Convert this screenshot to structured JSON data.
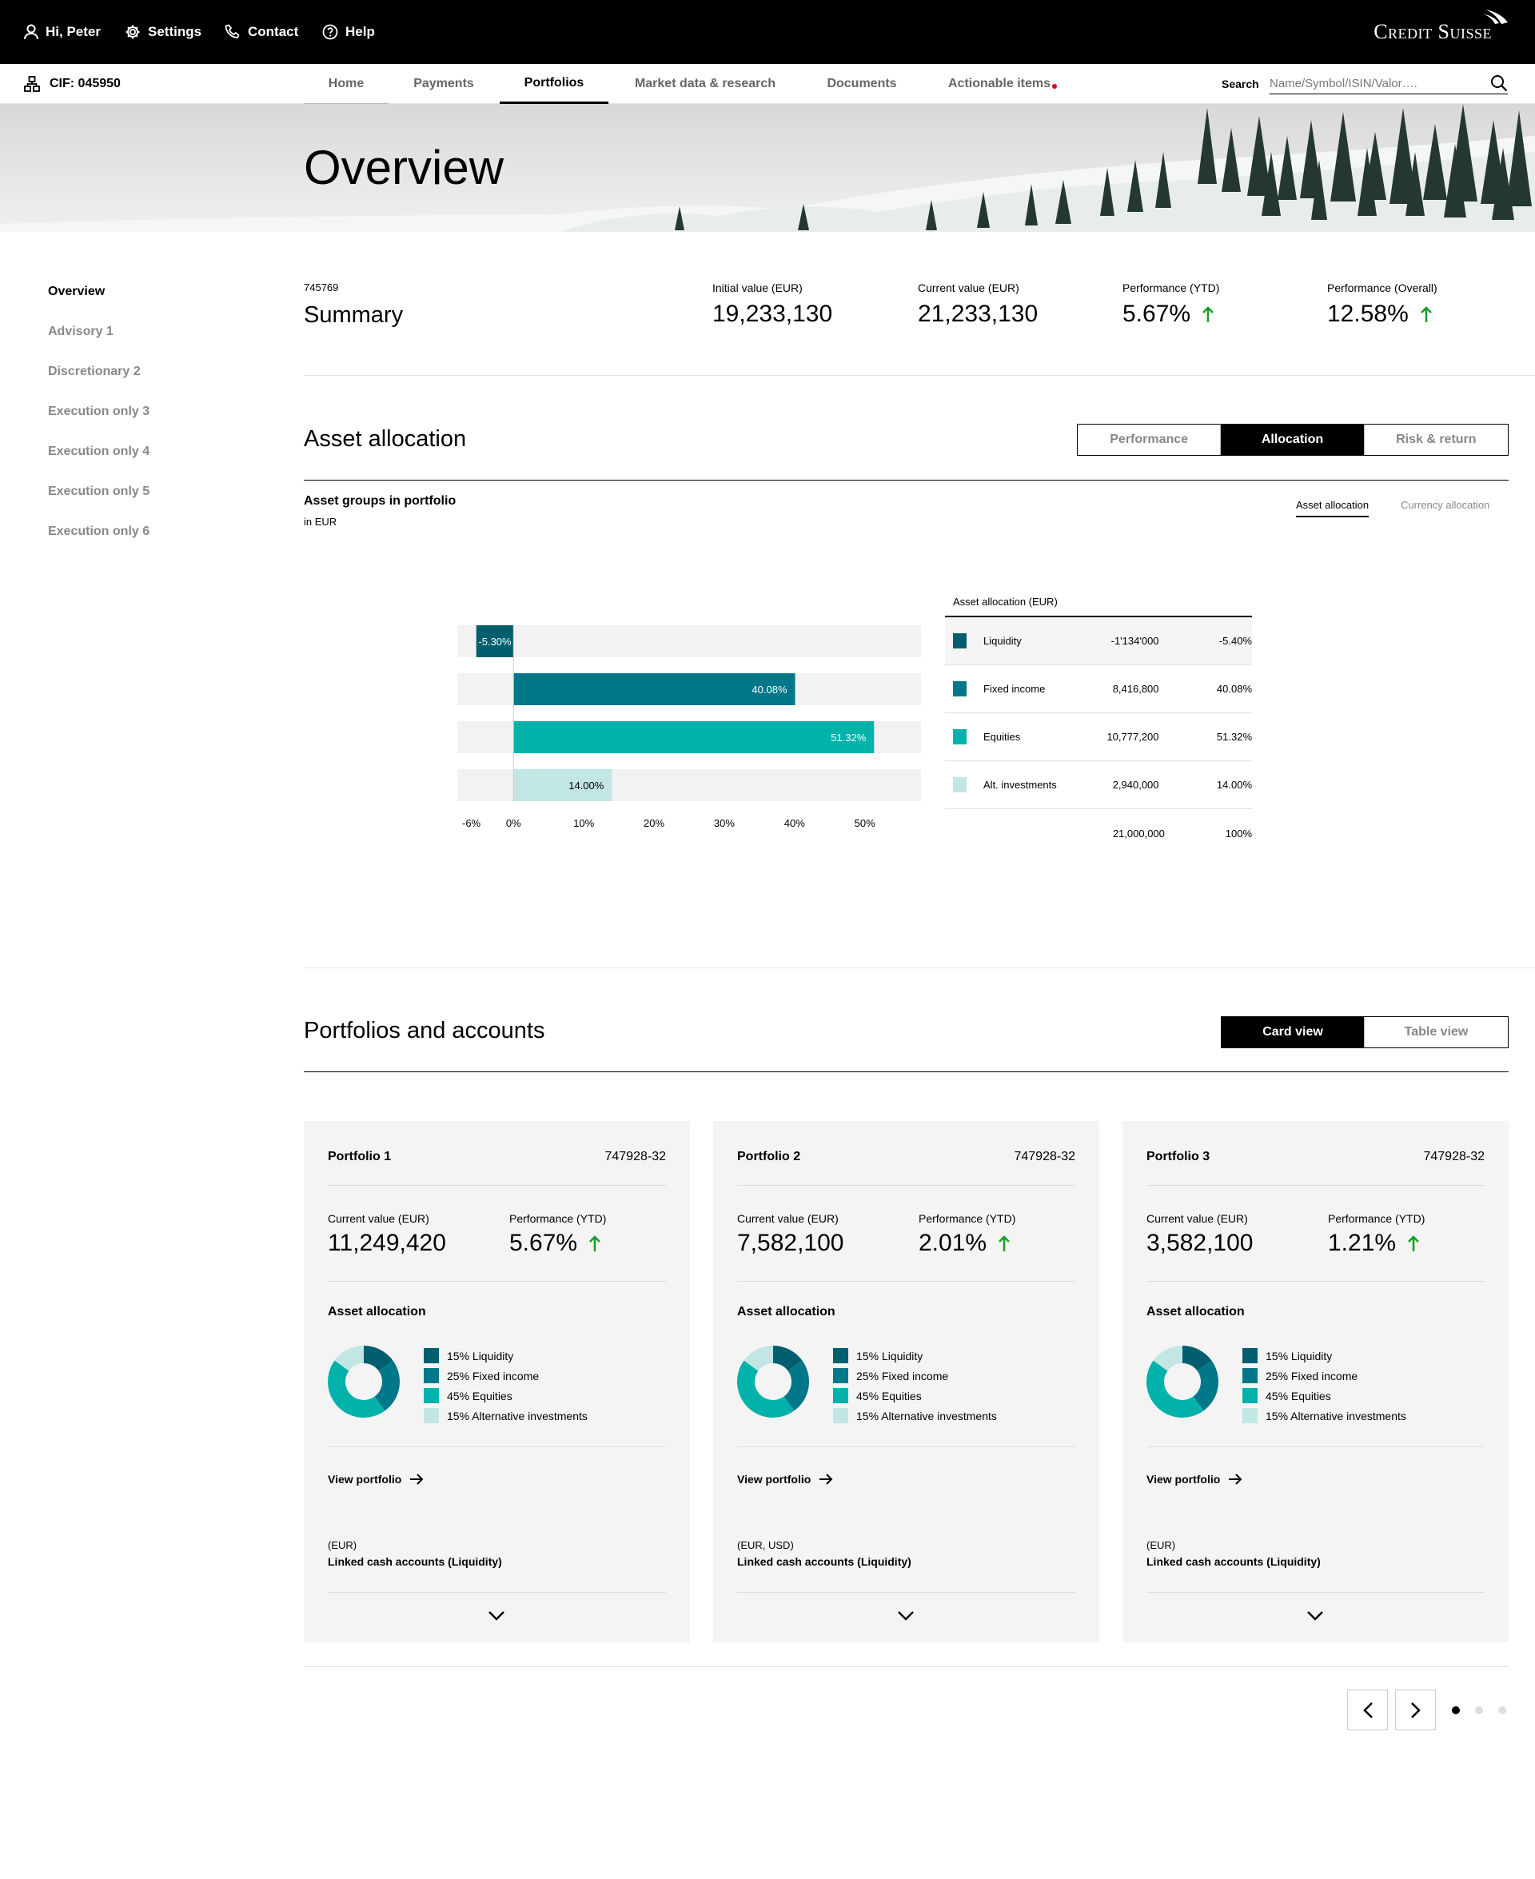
{
  "topbar": {
    "greeting": "Hi, Peter",
    "settings": "Settings",
    "contact": "Contact",
    "help": "Help",
    "brand": "Credit Suisse"
  },
  "nav": {
    "cif": "CIF: 045950",
    "tabs": [
      "Home",
      "Payments",
      "Portfolios",
      "Market data & research",
      "Documents",
      "Actionable items"
    ],
    "active_tab": "Portfolios",
    "notification_color": "#e0001b",
    "search_label": "Search",
    "search_placeholder": "Name/Symbol/ISIN/Valor…."
  },
  "hero": {
    "title": "Overview"
  },
  "sidebar": {
    "items": [
      "Overview",
      "Advisory 1",
      "Discretionary 2",
      "Execution only 3",
      "Execution only 4",
      "Execution only 5",
      "Execution only 6"
    ],
    "active": "Overview"
  },
  "summary": {
    "id": "745769",
    "title": "Summary",
    "kpis": [
      {
        "label": "Initial value (EUR)",
        "value": "19,233,130"
      },
      {
        "label": "Current value (EUR)",
        "value": "21,233,130"
      },
      {
        "label": "Performance (YTD)",
        "value": "5.67%",
        "trend": "up"
      },
      {
        "label": "Performance (Overall)",
        "value": "12.58%",
        "trend": "up"
      }
    ],
    "up_color": "#16a026"
  },
  "asset_allocation": {
    "title": "Asset allocation",
    "views": [
      "Performance",
      "Allocation",
      "Risk & return"
    ],
    "active_view": "Allocation",
    "subtitle": "Asset groups in portfolio",
    "unit": "in EUR",
    "subtabs": [
      "Asset allocation",
      "Currency allocation"
    ],
    "active_subtab": "Asset allocation",
    "table": {
      "header": "Asset allocation (EUR)",
      "rows": [
        {
          "name": "Liquidity",
          "amount": "-1'134'000",
          "percent": "-5.40%",
          "color": "#005e6e"
        },
        {
          "name": "Fixed income",
          "amount": "8,416,800",
          "percent": "40.08%",
          "color": "#00788a"
        },
        {
          "name": "Equities",
          "amount": "10,777,200",
          "percent": "51.32%",
          "color": "#00b2aa"
        },
        {
          "name": "Alt. investments",
          "amount": "2,940,000",
          "percent": "14.00%",
          "color": "#c1e6e3"
        }
      ],
      "total_amount": "21,000,000",
      "total_percent": "100%"
    }
  },
  "chart_data": {
    "type": "bar",
    "orientation": "horizontal",
    "categories": [
      "Liquidity",
      "Fixed income",
      "Equities",
      "Alt. investments"
    ],
    "values": [
      -5.3,
      40.08,
      51.32,
      14.0
    ],
    "labels": [
      "-5.30%",
      "40.08%",
      "51.32%",
      "14.00%"
    ],
    "colors": [
      "#005e6e",
      "#00788a",
      "#00b2aa",
      "#c1e6e3"
    ],
    "track_color": "#f2f2f2",
    "xticks": [
      "-6%",
      "0%",
      "10%",
      "20%",
      "30%",
      "40%",
      "50%"
    ],
    "xtick_values": [
      -6,
      0,
      10,
      20,
      30,
      40,
      50
    ],
    "xlim": [
      -8,
      58
    ],
    "grid": false
  },
  "portfolios": {
    "title": "Portfolios and accounts",
    "views": [
      "Card view",
      "Table view"
    ],
    "active_view": "Card view",
    "cards": [
      {
        "name": "Portfolio 1",
        "id": "747928-32",
        "current_label": "Current value (EUR)",
        "current_value": "11,249,420",
        "perf_label": "Performance (YTD)",
        "perf_value": "5.67%",
        "alloc_title": "Asset allocation",
        "legend": [
          "15% Liquidity",
          "25% Fixed income",
          "45% Equities",
          "15% Alternative investments"
        ],
        "view_link": "View portfolio",
        "currencies": "(EUR)",
        "linked": "Linked cash accounts (Liquidity)"
      },
      {
        "name": "Portfolio 2",
        "id": "747928-32",
        "current_label": "Current value (EUR)",
        "current_value": "7,582,100",
        "perf_label": "Performance (YTD)",
        "perf_value": "2.01%",
        "alloc_title": "Asset allocation",
        "legend": [
          "15% Liquidity",
          "25% Fixed income",
          "45% Equities",
          "15% Alternative investments"
        ],
        "view_link": "View portfolio",
        "currencies": "(EUR, USD)",
        "linked": "Linked cash accounts (Liquidity)"
      },
      {
        "name": "Portfolio 3",
        "id": "747928-32",
        "current_label": "Current value (EUR)",
        "current_value": "3,582,100",
        "perf_label": "Performance (YTD)",
        "perf_value": "1.21%",
        "alloc_title": "Asset allocation",
        "legend": [
          "15% Liquidity",
          "25% Fixed income",
          "45% Equities",
          "15% Alternative investments"
        ],
        "view_link": "View portfolio",
        "currencies": "(EUR)",
        "linked": "Linked cash accounts (Liquidity)"
      }
    ],
    "donut_shares": [
      15,
      25,
      45,
      15
    ],
    "donut_colors": [
      "#005e6e",
      "#00788a",
      "#00b2aa",
      "#c1e6e3"
    ],
    "pager": {
      "pages": 3,
      "current": 1
    }
  }
}
